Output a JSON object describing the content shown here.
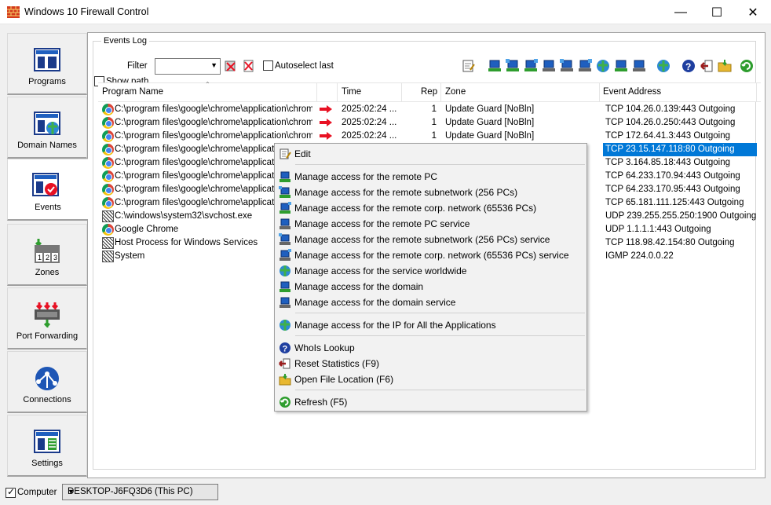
{
  "window": {
    "title": "Windows 10 Firewall Control",
    "minimize": "—",
    "maximize": "☐",
    "close": "✕"
  },
  "sidebar": {
    "items": [
      {
        "label": "Programs",
        "icon": "programs-icon"
      },
      {
        "label": "Domain Names",
        "icon": "domain-names-icon"
      },
      {
        "label": "Events",
        "icon": "events-icon"
      },
      {
        "label": "Zones",
        "icon": "zones-icon"
      },
      {
        "label": "Port Forwarding",
        "icon": "port-forwarding-icon"
      },
      {
        "label": "Connections",
        "icon": "connections-icon"
      },
      {
        "label": "Settings",
        "icon": "settings-icon"
      }
    ],
    "active": "Events"
  },
  "events_log": {
    "group_title": "Events Log",
    "filter_label": "Filter",
    "filter_value": "",
    "autoselect_label": "Autoselect last",
    "show_path_label": "Show path"
  },
  "columns": {
    "program": "Program Name",
    "time": "Time",
    "rep": "Rep",
    "zone": "Zone",
    "address": "Event Address"
  },
  "rows": [
    {
      "program": "C:\\program files\\google\\chrome\\application\\chrom...",
      "time": "2025:02:24 ...",
      "rep": "1",
      "zone": "Update Guard [NoBln]",
      "address": "TCP 104.26.0.139:443 Outgoing"
    },
    {
      "program": "C:\\program files\\google\\chrome\\application\\chrom...",
      "time": "2025:02:24 ...",
      "rep": "1",
      "zone": "Update Guard [NoBln]",
      "address": "TCP 104.26.0.250:443 Outgoing"
    },
    {
      "program": "C:\\program files\\google\\chrome\\application\\chrom...",
      "time": "2025:02:24 ...",
      "rep": "1",
      "zone": "Update Guard [NoBln]",
      "address": "TCP 172.64.41.3:443 Outgoing"
    },
    {
      "program": "C:\\program files\\google\\chrome\\application\\",
      "time": "",
      "rep": "",
      "zone": "",
      "address": "TCP 23.15.147.118:80 Outgoing"
    },
    {
      "program": "C:\\program files\\google\\chrome\\application\\",
      "time": "",
      "rep": "",
      "zone": "",
      "address": "TCP 3.164.85.18:443 Outgoing"
    },
    {
      "program": "C:\\program files\\google\\chrome\\application\\",
      "time": "",
      "rep": "",
      "zone": "",
      "address": "TCP 64.233.170.94:443 Outgoing"
    },
    {
      "program": "C:\\program files\\google\\chrome\\application\\",
      "time": "",
      "rep": "",
      "zone": "",
      "address": "TCP 64.233.170.95:443 Outgoing"
    },
    {
      "program": "C:\\program files\\google\\chrome\\application\\",
      "time": "",
      "rep": "",
      "zone": "",
      "address": "TCP 65.181.111.125:443 Outgoing"
    },
    {
      "program": "C:\\windows\\system32\\svchost.exe",
      "time": "",
      "rep": "",
      "zone": "",
      "address": "UDP 239.255.255.250:1900 Outgoing"
    },
    {
      "program": "Google Chrome",
      "time": "",
      "rep": "",
      "zone": "",
      "address": "UDP 1.1.1.1:443 Outgoing"
    },
    {
      "program": "Host Process for Windows Services",
      "time": "",
      "rep": "",
      "zone": "",
      "address": "TCP 118.98.42.154:80 Outgoing"
    },
    {
      "program": "System",
      "time": "",
      "rep": "",
      "zone": "",
      "address": "IGMP 224.0.0.22"
    }
  ],
  "context_menu": {
    "edit": "Edit",
    "items": [
      "Manage access for the remote PC",
      "Manage access for the remote subnetwork (256 PCs)",
      "Manage access for the remote corp. network (65536 PCs)",
      "Manage access for the remote PC service",
      "Manage access for the remote subnetwork (256 PCs) service",
      "Manage access for the remote corp. network (65536 PCs) service",
      "Manage access for the service worldwide",
      "Manage access for the domain",
      "Manage access for the domain service"
    ],
    "ip_all": "Manage access for the IP for All the Applications",
    "whois": "WhoIs Lookup",
    "reset": "Reset Statistics (F9)",
    "open_location": "Open File Location (F6)",
    "refresh": "Refresh (F5)"
  },
  "status": {
    "computer_label": "Computer",
    "computer_checked": true,
    "pc_value": "DESKTOP-J6FQ3D6 (This PC)"
  },
  "colors": {
    "selection": "#0078d7",
    "accent_red": "#e81123",
    "green": "#2e9d2e"
  }
}
